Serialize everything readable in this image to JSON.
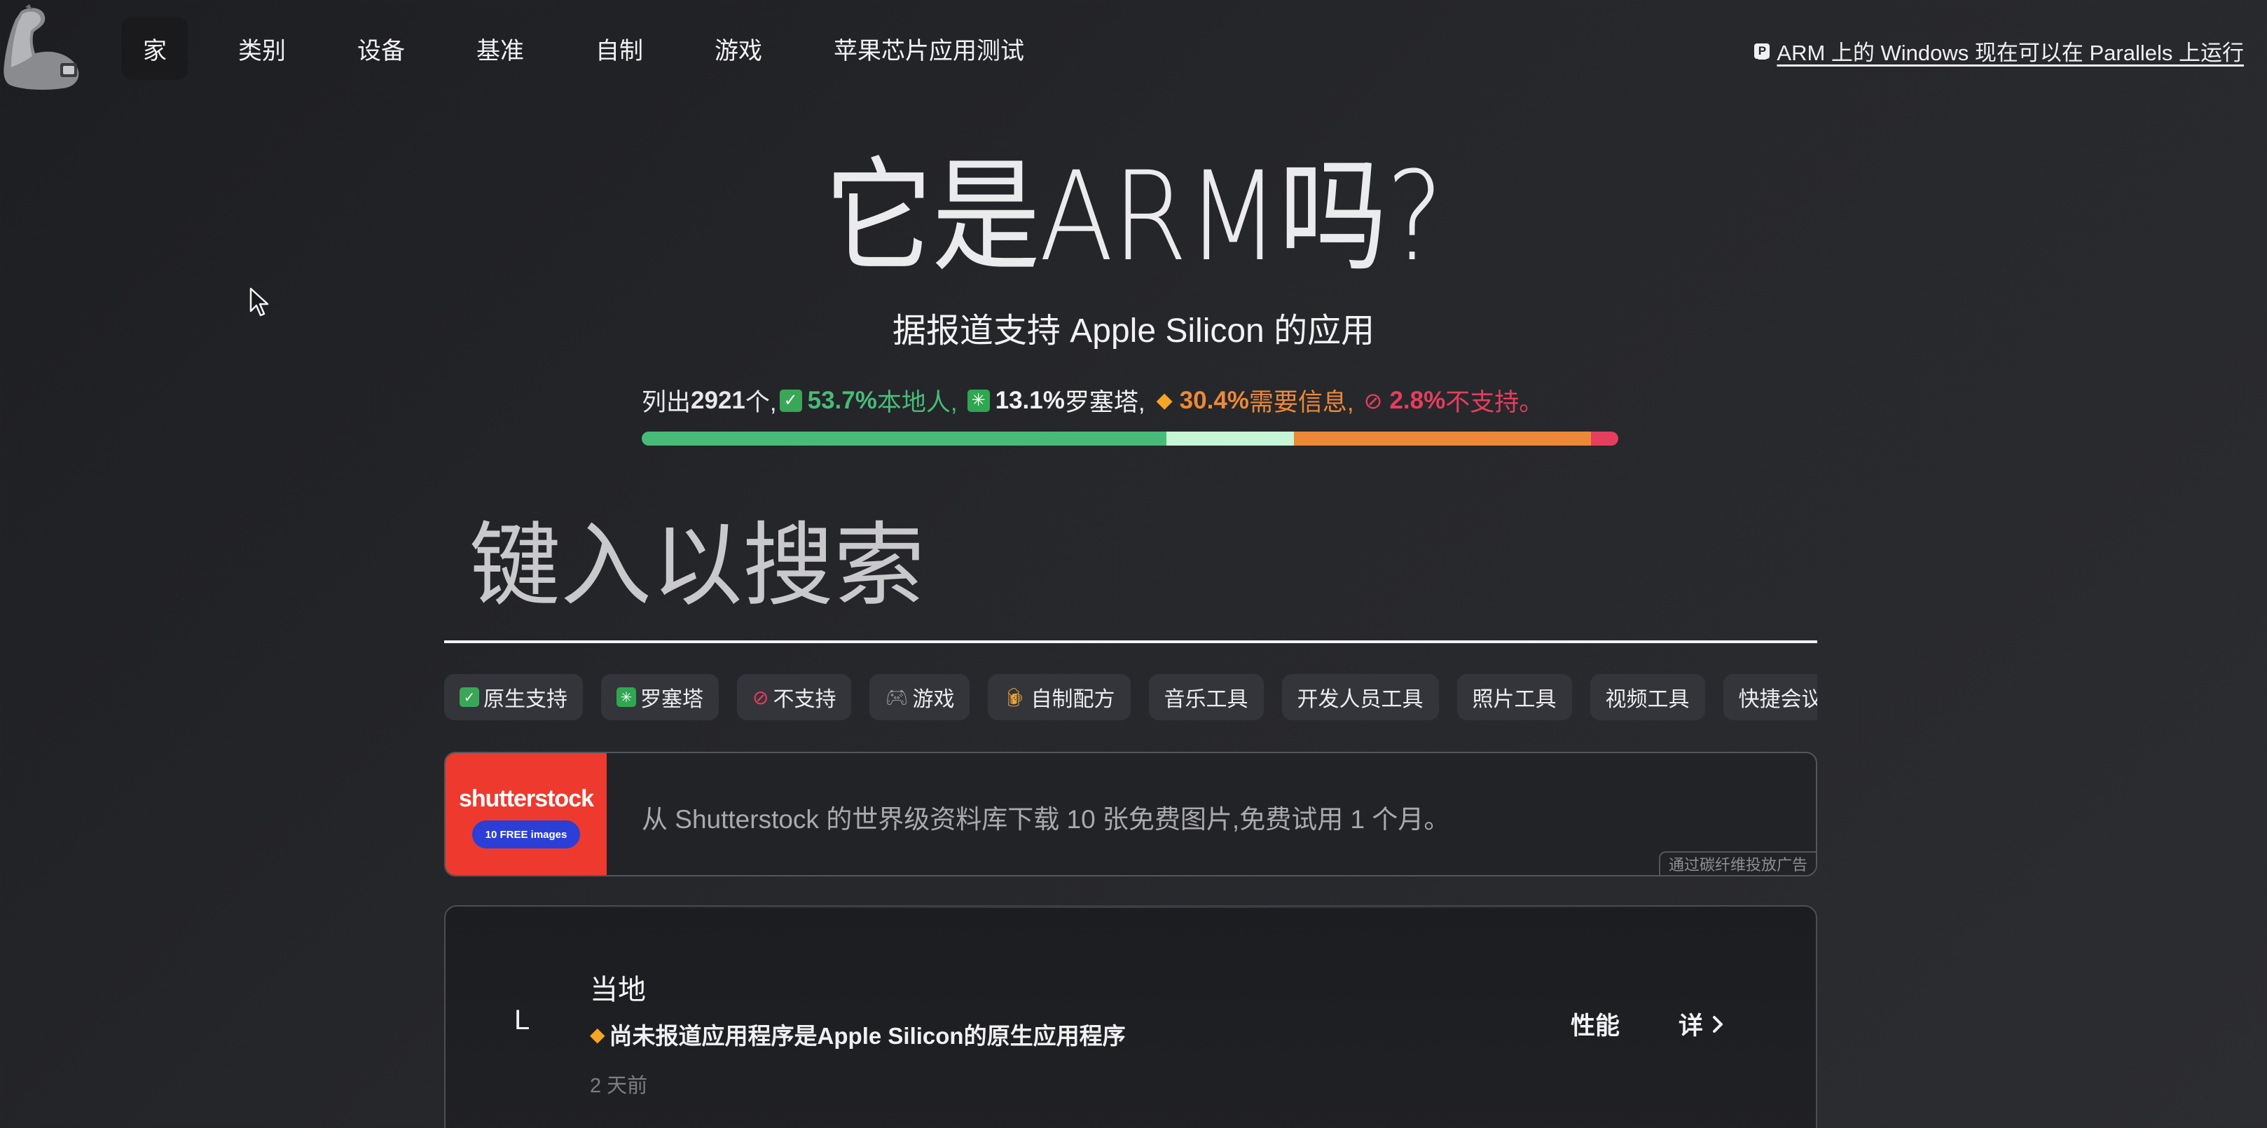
{
  "nav": {
    "items": [
      {
        "label": "家",
        "active": true
      },
      {
        "label": "类别"
      },
      {
        "label": "设备"
      },
      {
        "label": "基准"
      },
      {
        "label": "自制"
      },
      {
        "label": "游戏"
      },
      {
        "label": "苹果芯片应用测试"
      }
    ],
    "announcement": "ARM 上的 Windows 现在可以在 Parallels 上运行"
  },
  "hero": {
    "title": "它是ARM吗?",
    "subtitle": "据报道支持 Apple Silicon 的应用"
  },
  "stats": {
    "listed_prefix": "列出",
    "listed_count": "2921",
    "listed_suffix": "个,",
    "native_pct": "53.7%",
    "native_label": "本地人,",
    "rosetta_pct": "13.1%",
    "rosetta_label": "罗塞塔,",
    "unknown_pct": "30.4%",
    "unknown_label": "需要信息,",
    "unsupported_pct": "2.8%",
    "unsupported_label": "不支持。",
    "bar_fractions": {
      "native": 0.537,
      "rosetta": 0.131,
      "unknown": 0.304,
      "unsupported": 0.028
    },
    "colors": {
      "native": "#48bb78",
      "rosetta": "#c6f6d5",
      "unknown": "#ed8936",
      "unsupported": "#e53e5e"
    }
  },
  "search": {
    "placeholder": "键入以搜索"
  },
  "tags": [
    {
      "icon": "check-box-icon",
      "label": "原生支持"
    },
    {
      "icon": "asterisk-box-icon",
      "label": "罗塞塔"
    },
    {
      "icon": "prohibited-icon",
      "label": "不支持"
    },
    {
      "icon": "game-controller-icon",
      "label": "游戏"
    },
    {
      "icon": "beer-mug-icon",
      "label": "自制配方"
    },
    {
      "label": "音乐工具"
    },
    {
      "label": "开发人员工具"
    },
    {
      "label": "照片工具"
    },
    {
      "label": "视频工具"
    },
    {
      "label": "快捷会议"
    }
  ],
  "ad": {
    "brand": "shutterstock",
    "pill": "10 FREE images",
    "text": "从 Shutterstock 的世界级资料库下载 10 张免费图片,免费试用 1 个月。",
    "tag": "通过碳纤维投放广告"
  },
  "app_card": {
    "initial": "L",
    "name": "当地",
    "status": "尚未报道应用程序是Apple Silicon的原生应用程序",
    "time": "2 天前",
    "perf_label": "性能",
    "detail_label": "详"
  }
}
